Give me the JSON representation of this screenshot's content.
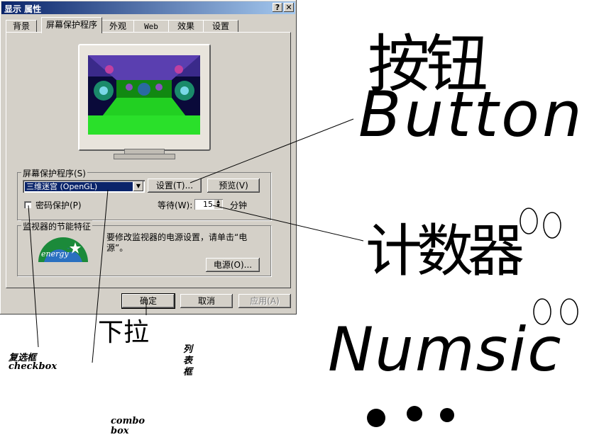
{
  "window": {
    "title": "显示 属性",
    "help_glyph": "?",
    "close_glyph": "✕"
  },
  "tabs": [
    {
      "label": "背景",
      "active": false
    },
    {
      "label": "屏幕保护程序",
      "active": true
    },
    {
      "label": "外观",
      "active": false
    },
    {
      "label": "Web",
      "active": false
    },
    {
      "label": "效果",
      "active": false
    },
    {
      "label": "设置",
      "active": false
    }
  ],
  "screensaver": {
    "group_label": "屏幕保护程序(S)",
    "selected": "三维迷宫 (OpenGL)",
    "settings_button": "设置(T)...",
    "preview_button": "预览(V)",
    "password_label": "密码保护(P)",
    "password_checked": false,
    "wait_label": "等待(W):",
    "wait_value": "15",
    "wait_unit": "分钟"
  },
  "energy": {
    "group_label": "监视器的节能特征",
    "description": "要修改监视器的电源设置，请单击“电源”。",
    "power_button": "电源(O)...",
    "logo_text": "energy"
  },
  "footer": {
    "ok": "确定",
    "cancel": "取消",
    "apply": "应用(A)",
    "apply_enabled": false
  },
  "annotations": {
    "button_zh": "按钮",
    "button_en": "Button",
    "dropdown_zh": "下拉",
    "listbox_zh": "列表框",
    "checkbox_zh": "复选框",
    "checkbox_en": "checkbox",
    "combo_en": "combo box",
    "counter_zh": "计数器",
    "numeric_en": "Numsic"
  },
  "colors": {
    "dialog_bg": "#d4d0c8",
    "titlebar": "#0a246a",
    "selection": "#0a246a",
    "screensaver_green": "#22d022"
  }
}
